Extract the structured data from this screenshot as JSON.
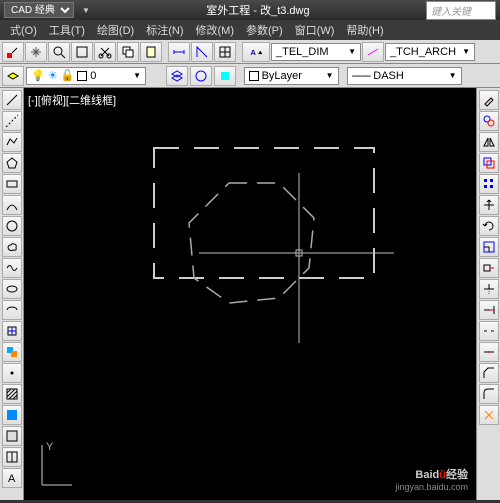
{
  "title": "室外工程 - 改_t3.dwg",
  "workspace": "CAD 经典",
  "search_placeholder": "键入关键",
  "menu": {
    "m0": "式(O)",
    "m1": "工具(T)",
    "m2": "绘图(D)",
    "m3": "标注(N)",
    "m4": "修改(M)",
    "m5": "参数(P)",
    "m6": "窗口(W)",
    "m7": "帮助(H)"
  },
  "toolbar2": {
    "tel_dim": "_TEL_DIM",
    "tch_arch": "_TCH_ARCH"
  },
  "layer": {
    "current": "0",
    "bylayer": "ByLayer",
    "dash": "DASH",
    "dash_prefix": "-------"
  },
  "view_label": "[-][俯视][二维线框]",
  "ucs": {
    "y": "Y"
  },
  "watermark": {
    "logo": "Baid",
    "logo2": "经验",
    "url": "jingyan.baidu.com"
  }
}
